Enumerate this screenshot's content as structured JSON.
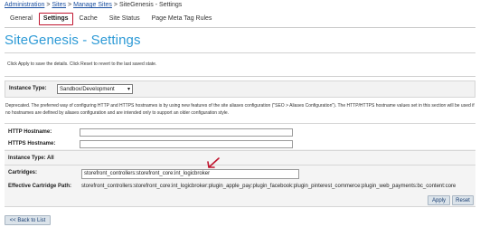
{
  "breadcrumb": {
    "items": [
      "Administration",
      "Sites",
      "Manage Sites"
    ],
    "current": "SiteGenesis - Settings",
    "separator": ">"
  },
  "tabs": [
    {
      "label": "General",
      "active": false
    },
    {
      "label": "Settings",
      "active": true
    },
    {
      "label": "Cache",
      "active": false
    },
    {
      "label": "Site Status",
      "active": false
    },
    {
      "label": "Page Meta Tag Rules",
      "active": false
    }
  ],
  "page_title": "SiteGenesis - Settings",
  "instructions": "Click Apply to save the details. Click Reset to revert to the last saved state.",
  "instance_type": {
    "label": "Instance Type:",
    "selected": "Sandbox/Development"
  },
  "description": "Deprecated. The preferred way of configuring HTTP and HTTPS hostnames is by using new features of the site aliases configuration (\"SEO > Aliases Configuration\"). The HTTP/HTTPS hostname values set in this section will be used if no hostnames are defined by aliases configuration and are intended only to support an older configuration style.",
  "form": {
    "http_hostname_label": "HTTP Hostname:",
    "http_hostname_value": "",
    "https_hostname_label": "HTTPS Hostname:",
    "https_hostname_value": "",
    "instance_type_all": "Instance Type:  All",
    "cartridges_label": "Cartridges:",
    "cartridges_value": "storefront_controllers:storefront_core:int_logicbroker",
    "effective_path_label": "Effective Cartridge Path:",
    "effective_path_value": "storefront_controllers:storefront_core:int_logicbroker:plugin_apple_pay:plugin_facebook:plugin_pinterest_commerce:plugin_web_payments:bc_content:core"
  },
  "buttons": {
    "apply": "Apply",
    "reset": "Reset",
    "back": "<< Back to List"
  },
  "colors": {
    "title": "#2d9ad6",
    "active_tab_border": "#c0152f",
    "arrow": "#c0152f",
    "button_bg": "#dbe3ea"
  },
  "icons": {
    "select_caret": "chevron-down-icon",
    "annotation_arrow": "arrow-down-left-icon"
  }
}
